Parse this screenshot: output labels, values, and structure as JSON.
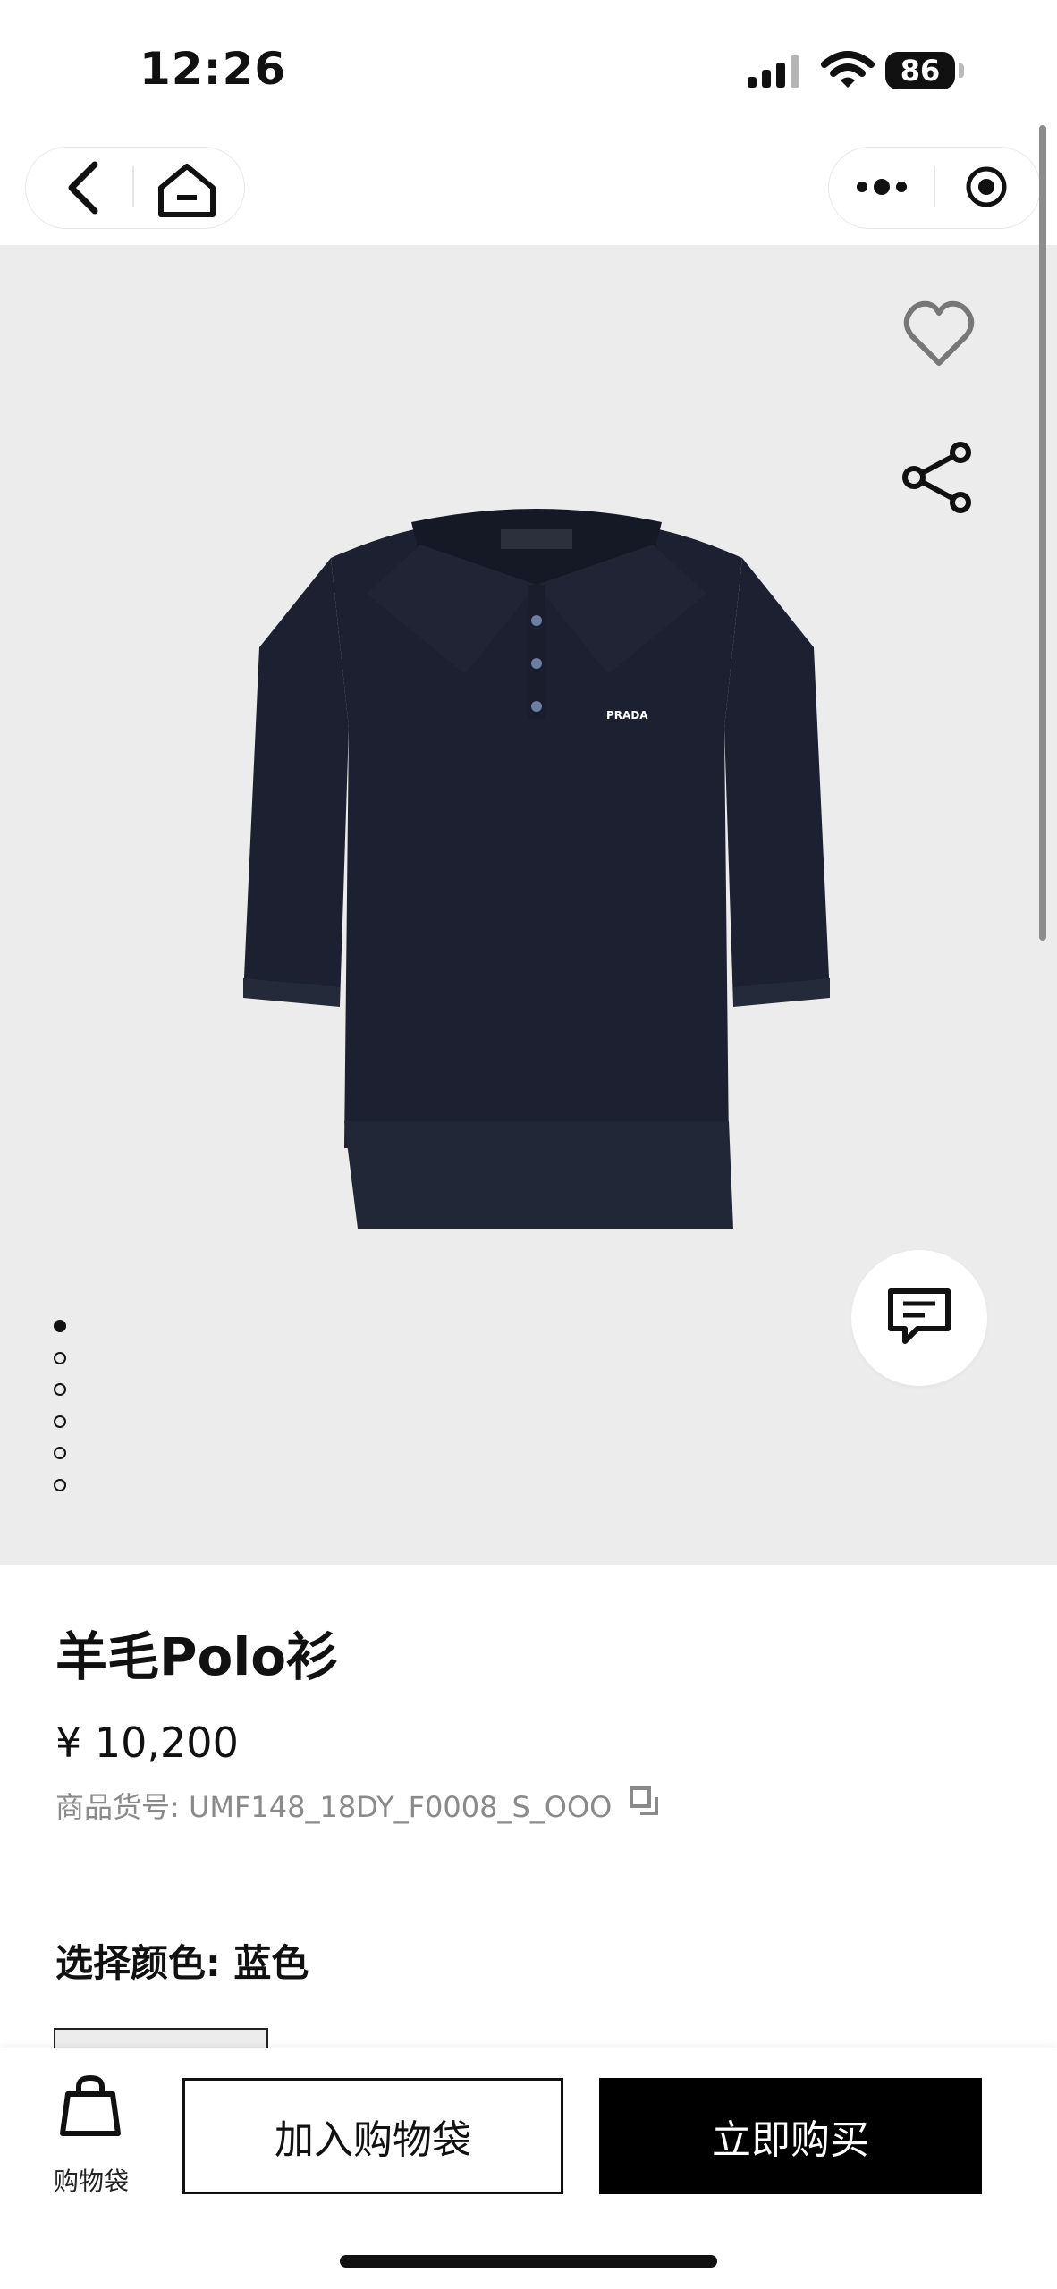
{
  "status_bar": {
    "time": "12:26",
    "battery": "86",
    "icons": [
      "signal-icon",
      "wifi-icon",
      "battery-icon"
    ]
  },
  "nav": {
    "icons": [
      "back-icon",
      "home-icon",
      "more-icon",
      "mini-program-close-icon"
    ]
  },
  "hero": {
    "image_alt": "Navy wool polo shirt",
    "page_dots": 6,
    "active_dot": 0,
    "icons": [
      "heart-icon",
      "share-icon",
      "chat-icon"
    ]
  },
  "product": {
    "title": "羊毛Polo衫",
    "price": "¥ 10,200",
    "sku": "商品货号: UMF148_18DY_F0008_S_OOO",
    "color_label": "选择颜色: 蓝色",
    "shirt_brand": "PRADA"
  },
  "bottom_bar": {
    "bag_label": "购物袋",
    "add_to_cart": "加入购物袋",
    "buy_now": "立即购买"
  },
  "colors": {
    "hero_bg": "#ececed",
    "shirt": "#1c2030",
    "primary": "#000000"
  }
}
